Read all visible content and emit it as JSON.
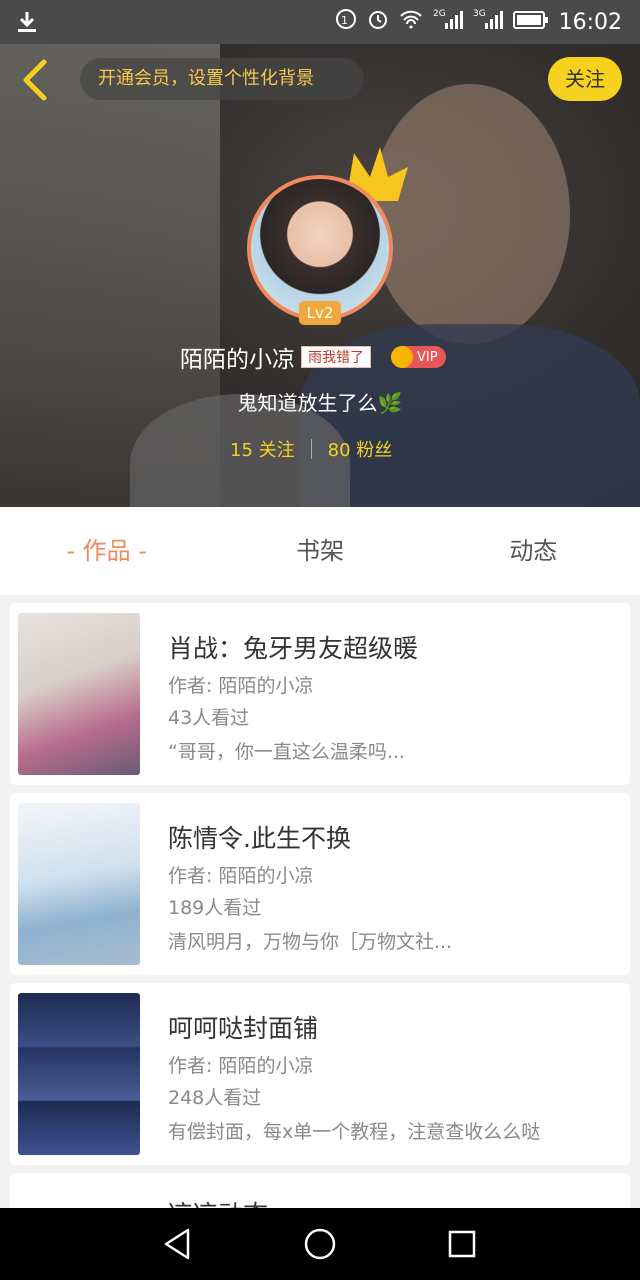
{
  "status_bar": {
    "time": "16:02",
    "icons": [
      "download-icon",
      "data-saver-icon",
      "alarm-icon",
      "wifi-icon",
      "signal-2g-icon",
      "signal-3g-icon",
      "battery-icon"
    ],
    "net1": "2G",
    "net2": "3G"
  },
  "header": {
    "vip_background_hint": "开通会员，设置个性化背景",
    "follow_label": "关注"
  },
  "profile": {
    "level": "Lv2",
    "username": "陌陌的小凉",
    "name_tag": "雨我错了",
    "vip_label": "VIP",
    "signature": "鬼知道放生了么🌿",
    "following": "15 关注",
    "followers": "80 粉丝"
  },
  "tabs": [
    {
      "label": "- 作品 -",
      "active": true
    },
    {
      "label": "书架",
      "active": false
    },
    {
      "label": "动态",
      "active": false
    }
  ],
  "works": [
    {
      "title": "肖战：兔牙男友超级暖",
      "author": "作者: 陌陌的小凉",
      "views": "43人看过",
      "desc": "“哥哥，你一直这么温柔吗..."
    },
    {
      "title": "陈情令.此生不换",
      "author": "作者: 陌陌的小凉",
      "views": "189人看过",
      "desc": "清风明月，万物与你［万物文社..."
    },
    {
      "title": "呵呵哒封面铺",
      "author": "作者: 陌陌的小凉",
      "views": "248人看过",
      "desc": "有偿封面，每x单一个教程，注意查收么么哒"
    },
    {
      "title": "凉凉动态",
      "author": "",
      "views": "",
      "desc": ""
    }
  ],
  "colors": {
    "accent": "#f08a5d",
    "follow_yellow": "#f6d21e",
    "vip_red": "#e8565a"
  }
}
